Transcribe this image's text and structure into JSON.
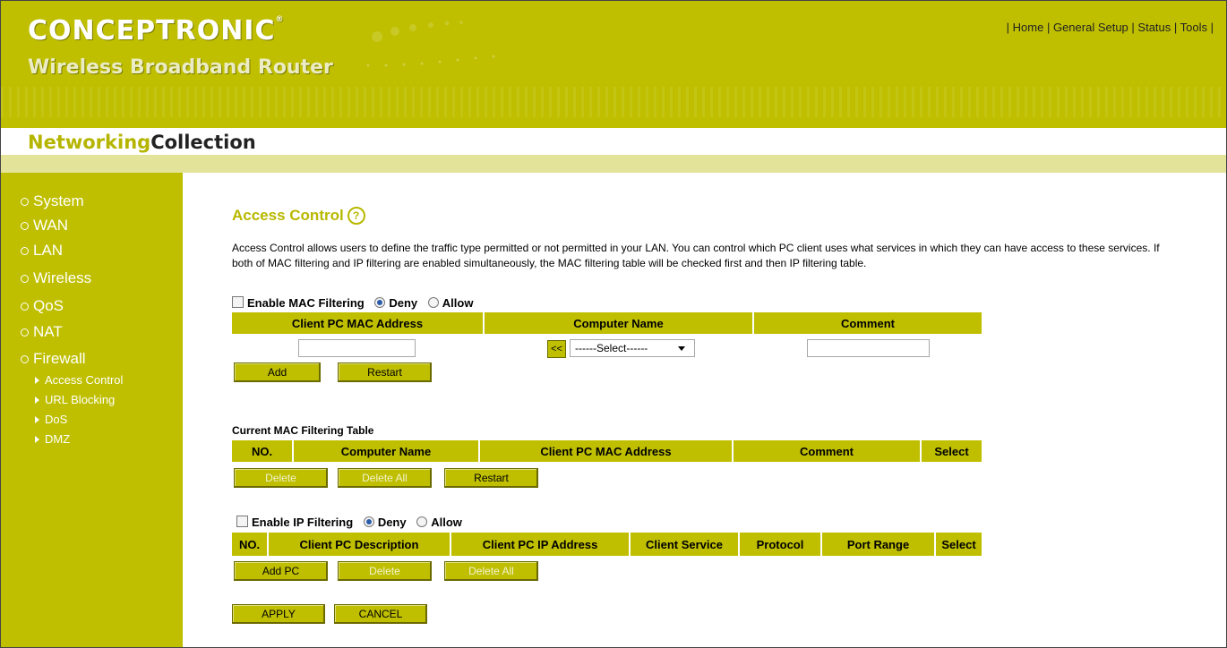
{
  "header": {
    "brand": "CONCEPTRONIC",
    "subtitle": "Wireless Broadband Router",
    "collection_part1": "Networking",
    "collection_part2": "Collection",
    "nav": [
      "Home",
      "General Setup",
      "Status",
      "Tools"
    ]
  },
  "sidebar": {
    "items": [
      "System",
      "WAN",
      "LAN",
      "Wireless",
      "QoS",
      "NAT",
      "Firewall"
    ],
    "subitems": [
      "Access Control",
      "URL Blocking",
      "DoS",
      "DMZ"
    ]
  },
  "main": {
    "title": "Access Control",
    "description": "Access Control allows users to define the traffic type permitted or not permitted in your LAN. You can control which PC client uses what services in which they can have access to these services. If both of MAC filtering and IP filtering are enabled simultaneously, the MAC filtering table will be checked first and then IP filtering table.",
    "mac": {
      "enable_label": "Enable MAC Filtering",
      "deny_label": "Deny",
      "allow_label": "Allow",
      "mode": "Deny",
      "headers": [
        "Client PC MAC Address",
        "Computer Name",
        "Comment"
      ],
      "mac_value": "",
      "comment_value": "",
      "select_button": "<<",
      "select_value": "------Select------",
      "add_button": "Add",
      "restart_button": "Restart"
    },
    "mac_table": {
      "title": "Current MAC Filtering Table",
      "headers": [
        "NO.",
        "Computer Name",
        "Client PC MAC Address",
        "Comment",
        "Select"
      ],
      "delete_button": "Delete",
      "delete_all_button": "Delete All",
      "restart_button": "Restart"
    },
    "ip": {
      "enable_label": "Enable IP Filtering",
      "deny_label": "Deny",
      "allow_label": "Allow",
      "mode": "Deny",
      "headers": [
        "NO.",
        "Client PC Description",
        "Client PC IP Address",
        "Client Service",
        "Protocol",
        "Port Range",
        "Select"
      ],
      "add_pc_button": "Add PC",
      "delete_button": "Delete",
      "delete_all_button": "Delete All"
    },
    "apply_button": "APPLY",
    "cancel_button": "CANCEL"
  },
  "colors": {
    "olive": "#bfbf00",
    "light_olive": "#e3e39a",
    "title_color": "#b8b800"
  }
}
